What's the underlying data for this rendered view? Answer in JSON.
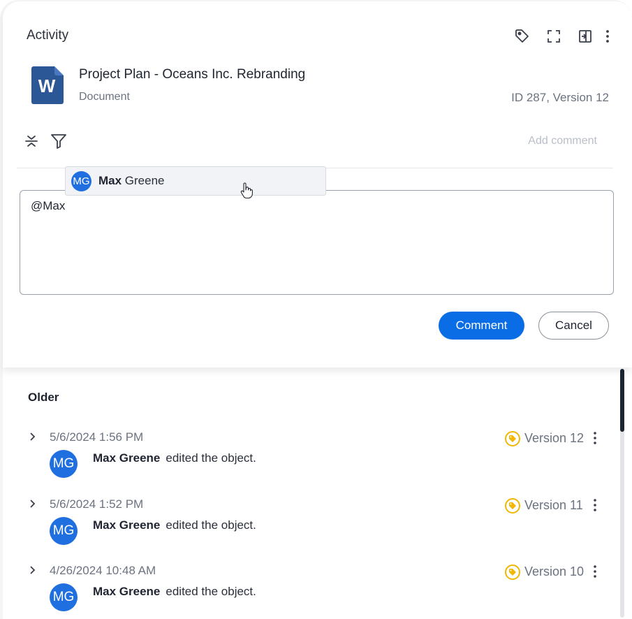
{
  "header": {
    "title": "Activity",
    "icons": [
      "tag-icon",
      "fullscreen-icon",
      "panel-icon",
      "more-vertical-icon"
    ]
  },
  "document": {
    "icon_letter": "W",
    "title": "Project Plan - Oceans Inc. Rebranding",
    "type": "Document",
    "id_version": "ID 287, Version 12"
  },
  "toolbar": {
    "add_comment": "Add comment",
    "icons": [
      "collapse-icon",
      "filter-icon"
    ]
  },
  "mention": {
    "initials": "MG",
    "match": "Max",
    "rest": " Greene"
  },
  "comment_box": {
    "value": "@Max"
  },
  "buttons": {
    "comment": "Comment",
    "cancel": "Cancel"
  },
  "older": {
    "heading": "Older",
    "entries": [
      {
        "timestamp": "5/6/2024 1:56 PM",
        "initials": "MG",
        "user": "Max Greene",
        "action": "edited the object.",
        "version": "Version 12"
      },
      {
        "timestamp": "5/6/2024 1:52 PM",
        "initials": "MG",
        "user": "Max Greene",
        "action": "edited the object.",
        "version": "Version 11"
      },
      {
        "timestamp": "4/26/2024 10:48 AM",
        "initials": "MG",
        "user": "Max Greene",
        "action": "edited the object.",
        "version": "Version 10"
      }
    ]
  },
  "colors": {
    "accent": "#0a6de6",
    "avatar": "#1f6fe0",
    "word_blue": "#2b5797",
    "tag_yellow": "#f2b705"
  }
}
